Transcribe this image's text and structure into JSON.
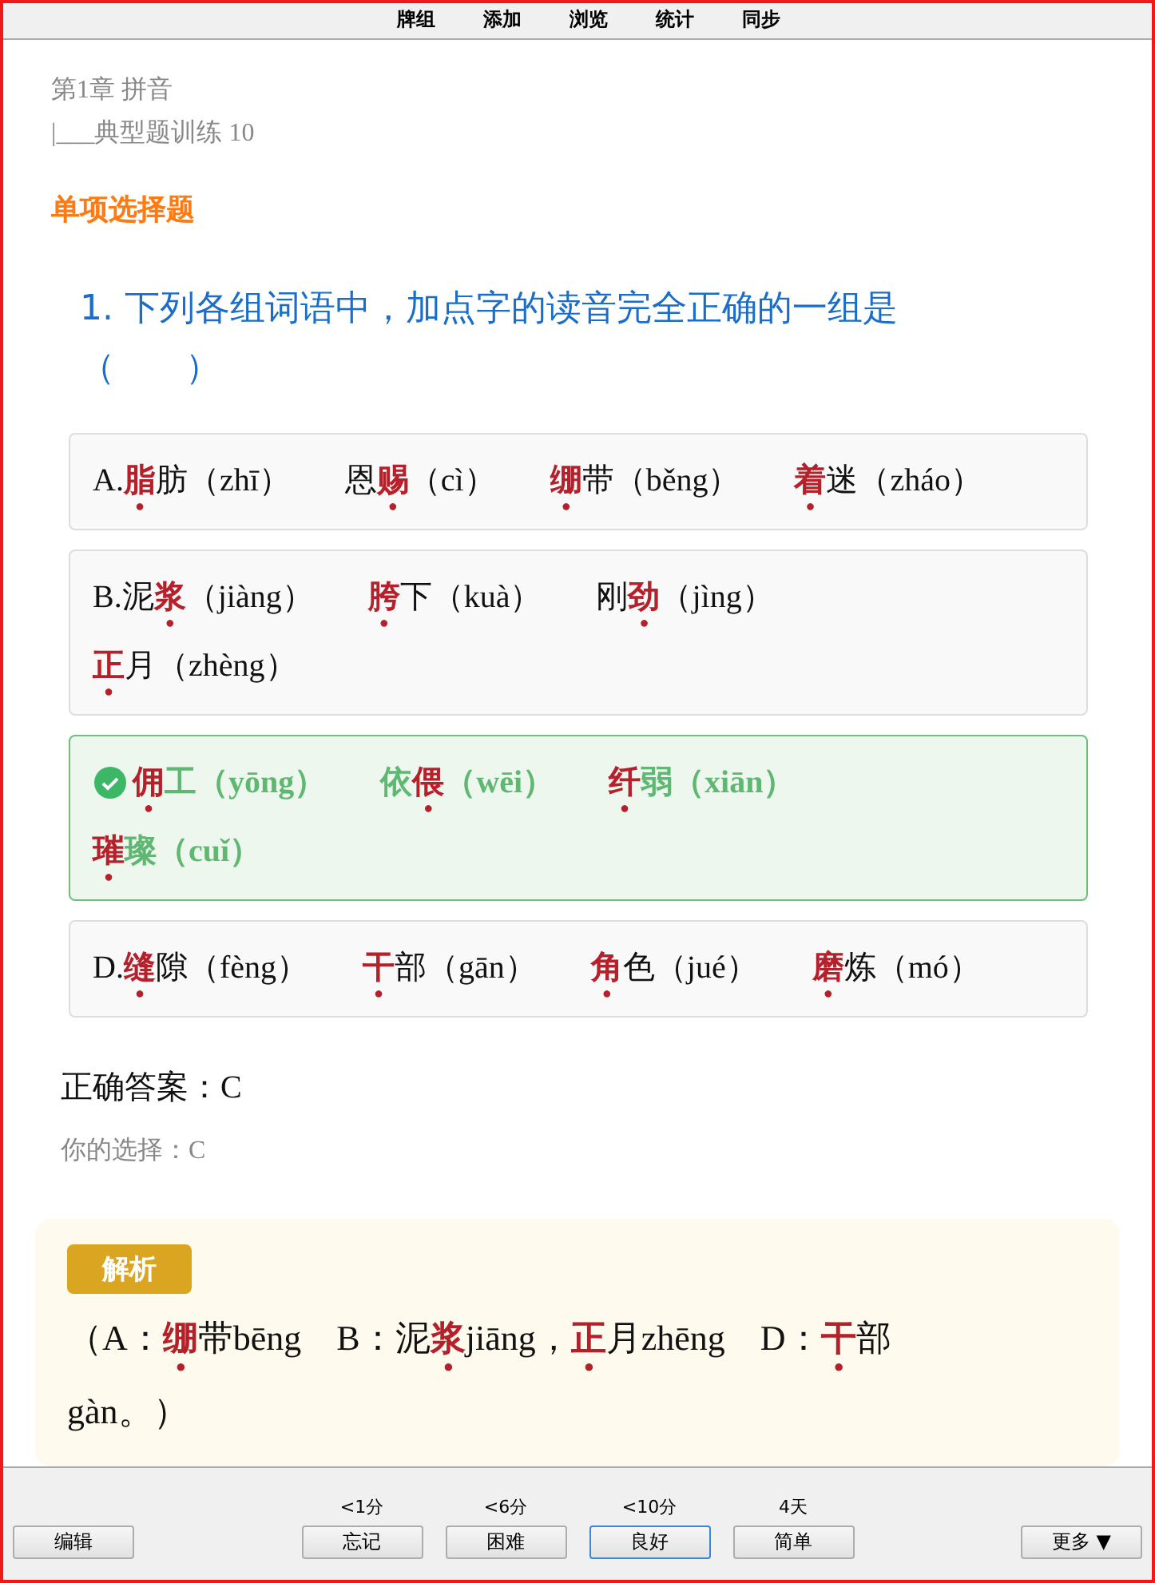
{
  "menu": [
    {
      "label": "牌组"
    },
    {
      "label": "添加"
    },
    {
      "label": "浏览"
    },
    {
      "label": "统计"
    },
    {
      "label": "同步"
    }
  ],
  "breadcrumb": [
    "第1章 拼音",
    "|___典型题训练 10"
  ],
  "section_title": "单项选择题",
  "question": {
    "number": "1.",
    "text": "下列各组词语中，加点字的读音完全正确的一组是（　　）"
  },
  "options": [
    {
      "label": "A.",
      "selected": false,
      "correct": false,
      "words": [
        "**脂**肪（zhī）",
        "恩**赐**（cì）",
        "**绷**带（běng）",
        "**着**迷（zháo）"
      ]
    },
    {
      "label": "B.",
      "selected": false,
      "correct": false,
      "words": [
        "泥**浆**（jiàng）",
        "**胯**下（kuà）",
        "刚**劲**（jìng）",
        "**正**月（zhèng）"
      ]
    },
    {
      "selected": true,
      "correct": true,
      "words": [
        "**佣**工（yōng）",
        "依**偎**（wēi）",
        "**纤**弱（xiān）",
        "**璀**璨（cuǐ）"
      ]
    },
    {
      "label": "D.",
      "selected": false,
      "correct": false,
      "words": [
        "**缝**隙（fèng）",
        "**干**部（gān）",
        "**角**色（jué）",
        "**磨**炼（mó）"
      ]
    }
  ],
  "correct_answer": "正确答案：C",
  "your_choice": "你的选择：C",
  "explanation": {
    "badge": "解析",
    "text": "（A：**绷**带bēng　B：泥**浆**jiāng，**正**月zhēng　D：**干**部gàn。）"
  },
  "footer": {
    "edit": "编辑",
    "more": "更多 ▼",
    "answers": [
      {
        "interval": "<1分",
        "label": "忘记",
        "selected": false
      },
      {
        "interval": "<6分",
        "label": "困难",
        "selected": false
      },
      {
        "interval": "<10分",
        "label": "良好",
        "selected": true
      },
      {
        "interval": "4天",
        "label": "简单",
        "selected": false
      }
    ]
  }
}
